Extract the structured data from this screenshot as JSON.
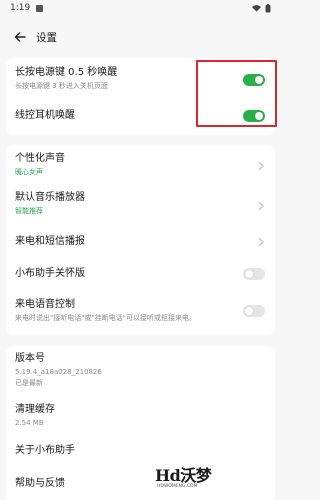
{
  "status_bar": {
    "time": "1:19"
  },
  "header": {
    "title": "设置"
  },
  "wake": {
    "power_key": {
      "title": "长按电源键 0.5 秒唤醒",
      "subtitle": "长按电源键 3 秒进入关机页面",
      "enabled": true
    },
    "headset": {
      "title": "线控耳机唤醒",
      "enabled": true
    }
  },
  "sound": {
    "voice": {
      "title": "个性化声音",
      "value": "暖心女声"
    },
    "player": {
      "title": "默认音乐播放器",
      "value": "智能推荐"
    },
    "announce": {
      "title": "来电和短信播报"
    },
    "care": {
      "title": "小布助手关怀版",
      "enabled": false
    },
    "voice_control": {
      "title": "来电语音控制",
      "subtitle": "来电时说出\"接听电话\"或\"挂断电话\"可以接听或拒接来电。",
      "enabled": false
    }
  },
  "info": {
    "version": {
      "title": "版本号",
      "value": "5.19.4_a18a028_210826",
      "status": "已是最新"
    },
    "cache": {
      "title": "清理缓存",
      "value": "2.54 MB"
    },
    "about": {
      "title": "关于小布助手"
    },
    "help": {
      "title": "帮助与反馈"
    }
  },
  "watermark": {
    "main": "Hd沃梦",
    "sub": "HDWOMENG.COM"
  },
  "colors": {
    "accent_green": "#28b047",
    "highlight_red": "#d8282f",
    "background": "#f7f7f7"
  }
}
